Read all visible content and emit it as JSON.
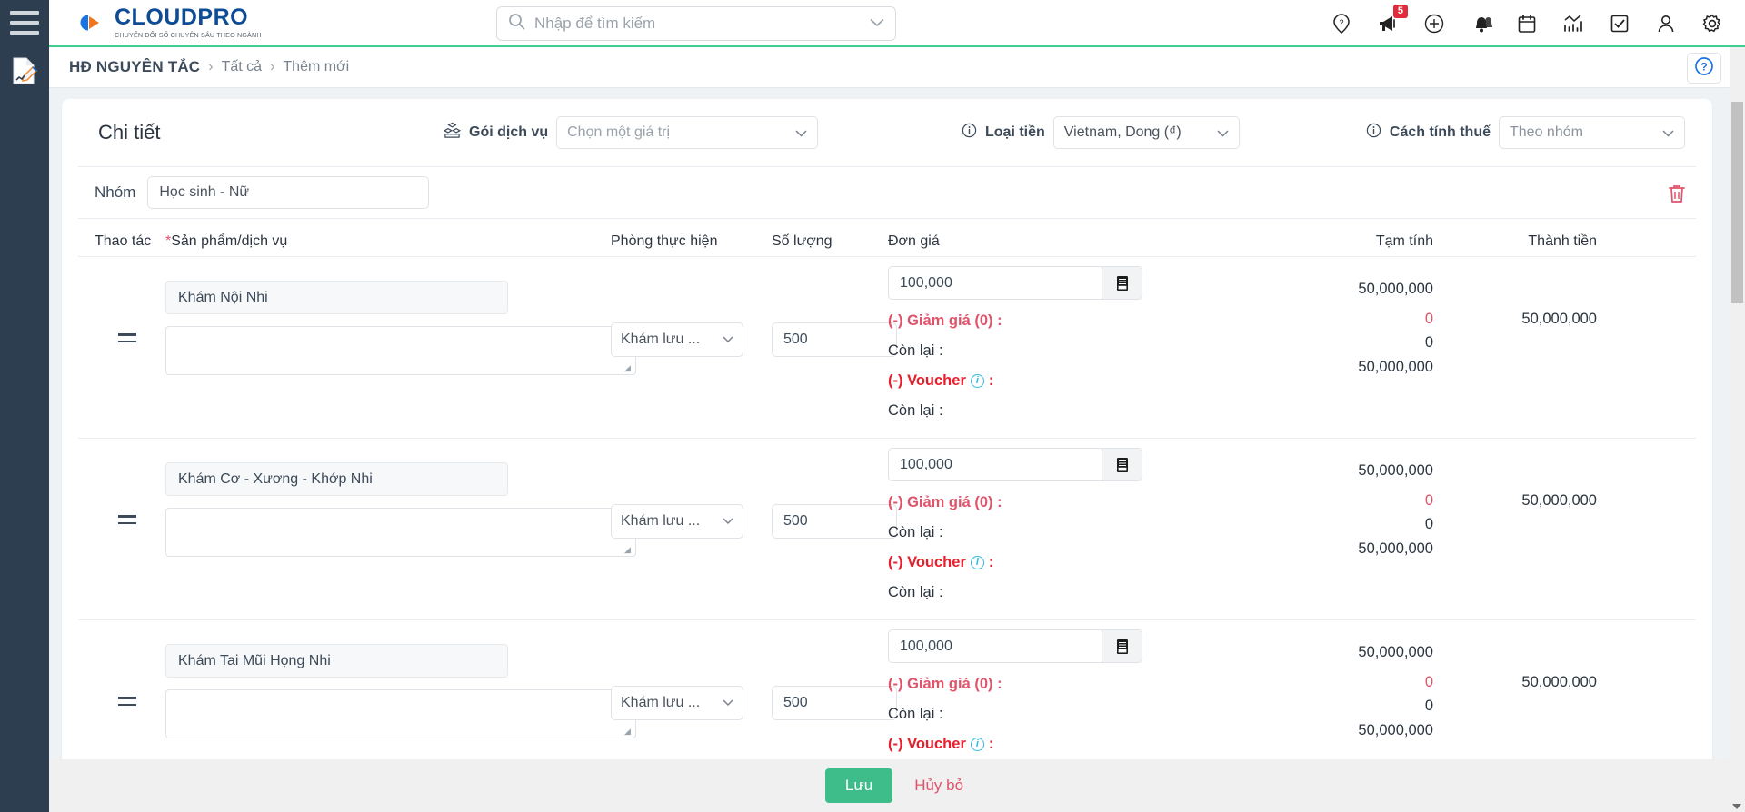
{
  "brand": {
    "name_cloud": "CLOUD",
    "name_pro": "PRO",
    "tagline": "CHUYỂN ĐỔI SỐ CHUYÊN SÂU THEO NGÀNH",
    "primary_color": "#0f4c96",
    "accent_color": "#ee7623",
    "green_line": "#3ecf8e"
  },
  "search": {
    "placeholder": "Nhập để tìm kiếm",
    "value": ""
  },
  "topbar": {
    "icons": [
      {
        "name": "help-pin-icon",
        "label": "Trợ giúp"
      },
      {
        "name": "megaphone-icon",
        "label": "Thông báo",
        "badge": "5"
      },
      {
        "name": "plus-circle-icon",
        "label": "Thêm mới"
      },
      {
        "name": "bell-icon",
        "label": "Nhắc nhở"
      },
      {
        "name": "calendar-icon",
        "label": "Lịch"
      },
      {
        "name": "chart-icon",
        "label": "Báo cáo"
      },
      {
        "name": "task-check-icon",
        "label": "Công việc"
      },
      {
        "name": "user-icon",
        "label": "Tài khoản"
      },
      {
        "name": "gear-icon",
        "label": "Cài đặt"
      }
    ]
  },
  "breadcrumb": {
    "root": "HĐ NGUYÊN TẮC",
    "sep": "›",
    "items": [
      "Tất cả",
      "Thêm mới"
    ],
    "help_icon": "question-circle-icon"
  },
  "detail": {
    "title": "Chi tiết",
    "service_package": {
      "label": "Gói dịch vụ",
      "icon": "package-icon",
      "value": "Chọn một giá trị",
      "is_placeholder": true
    },
    "currency": {
      "label": "Loại tiền",
      "icon": "info-circle-icon",
      "value": "Vietnam, Dong (₫)"
    },
    "tax_method": {
      "label": "Cách tính thuế",
      "icon": "info-circle-icon",
      "value": "Theo nhóm"
    }
  },
  "group": {
    "label": "Nhóm",
    "value": "Học sinh - Nữ",
    "delete_icon": "trash-icon"
  },
  "table": {
    "headers": {
      "action": "Thao tác",
      "product_req": "*",
      "product": "Sản phẩm/dịch vụ",
      "room": "Phòng thực hiện",
      "quantity": "Số lượng",
      "unit_price": "Đơn giá",
      "subtotal": "Tạm tính",
      "total": "Thành tiền"
    },
    "price_labels": {
      "discount": "(-) Giảm giá (0) :",
      "remaining1": "Còn lại :",
      "voucher_prefix": "(-)  Voucher",
      "voucher_suffix": ":",
      "remaining2": "Còn lại :"
    },
    "rows": [
      {
        "product": "Khám Nội Nhi",
        "note": "",
        "room": "Khám lưu ...",
        "quantity": "500",
        "unit_price": "100,000",
        "subtotal": "50,000,000",
        "discount_amount": "0",
        "remaining_after_discount": "0",
        "remaining_after_voucher": "50,000,000",
        "total": "50,000,000",
        "price_book_icon": "price-book-icon"
      },
      {
        "product": "Khám Cơ - Xương - Khớp Nhi",
        "note": "",
        "room": "Khám lưu ...",
        "quantity": "500",
        "unit_price": "100,000",
        "subtotal": "50,000,000",
        "discount_amount": "0",
        "remaining_after_discount": "0",
        "remaining_after_voucher": "50,000,000",
        "total": "50,000,000",
        "price_book_icon": "price-book-icon"
      },
      {
        "product": "Khám Tai Mũi Họng Nhi",
        "note": "",
        "room": "Khám lưu ...",
        "quantity": "500",
        "unit_price": "100,000",
        "subtotal": "50,000,000",
        "discount_amount": "0",
        "remaining_after_discount": "0",
        "remaining_after_voucher": "50,000,000",
        "total": "50,000,000",
        "price_book_icon": "price-book-icon"
      }
    ]
  },
  "footer": {
    "save_label": "Lưu",
    "cancel_label": "Hủy bỏ",
    "save_color": "#3ebd8a",
    "cancel_color": "#e0536b"
  },
  "sidebar": {
    "menu_icon": "hamburger-icon",
    "items": [
      {
        "name": "contract-edit-icon",
        "label": "Hợp đồng"
      }
    ]
  }
}
